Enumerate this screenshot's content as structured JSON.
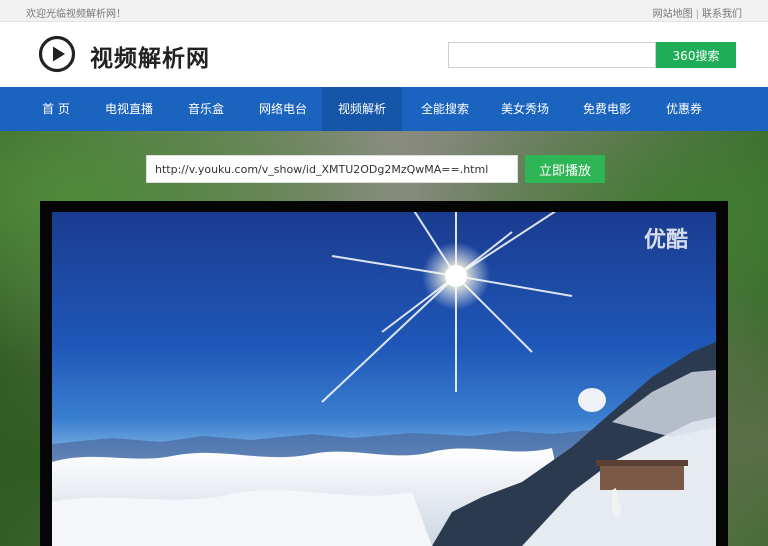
{
  "topbar": {
    "welcome": "欢迎光临视频解析网！",
    "sitemap": "网站地图",
    "separator": "|",
    "contact": "联系我们"
  },
  "header": {
    "logo_text": "视频解析网",
    "search_placeholder": "",
    "search_button": "360搜索"
  },
  "nav": {
    "items": [
      {
        "label": "首 页"
      },
      {
        "label": "电视直播"
      },
      {
        "label": "音乐盒"
      },
      {
        "label": "网络电台"
      },
      {
        "label": "视频解析"
      },
      {
        "label": "全能搜索"
      },
      {
        "label": "美女秀场"
      },
      {
        "label": "免费电影"
      },
      {
        "label": "优惠券"
      }
    ],
    "active_index": 4
  },
  "player": {
    "url_value": "http://v.youku.com/v_show/id_XMTU2ODg2MzQwMA==.html",
    "play_button": "立即播放",
    "watermark": "优酷"
  },
  "colors": {
    "nav_bg": "#1a63bf",
    "nav_active": "#1556a8",
    "search_button": "#1fae57",
    "play_button": "#2db556"
  }
}
